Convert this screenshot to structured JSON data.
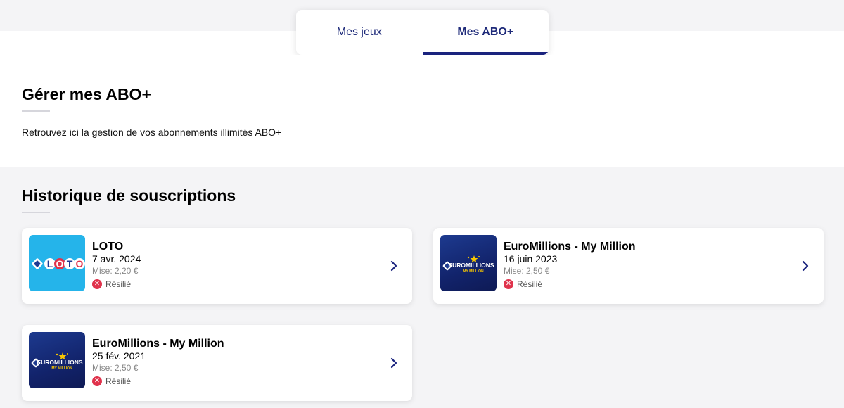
{
  "tabs": [
    {
      "label": "Mes jeux",
      "active": false
    },
    {
      "label": "Mes ABO+",
      "active": true
    }
  ],
  "manage": {
    "title": "Gérer mes ABO+",
    "subtitle": "Retrouvez ici la gestion de vos abonnements illimités ABO+"
  },
  "history": {
    "title": "Historique de souscriptions",
    "cards": [
      {
        "name": "LOTO",
        "date": "7 avr. 2024",
        "mise": "Mise: 2,20 €",
        "status": "Résilié",
        "logo": "loto-logo"
      },
      {
        "name": "EuroMillions - My Million",
        "date": "16 juin 2023",
        "mise": "Mise: 2,50 €",
        "status": "Résilié",
        "logo": "euromillions-logo"
      },
      {
        "name": "EuroMillions - My Million",
        "date": "25 fév. 2021",
        "mise": "Mise: 2,50 €",
        "status": "Résilié",
        "logo": "euromillions-logo"
      }
    ]
  },
  "logos": {
    "loto_text": "LOTO",
    "euro_text": "EUROMILLIONS",
    "euro_sub": "MY MILLION"
  },
  "colors": {
    "accent": "#1a237e",
    "status_red": "#e0334c",
    "loto_blue": "#25b4ea",
    "euro_navy": "#12236b"
  }
}
